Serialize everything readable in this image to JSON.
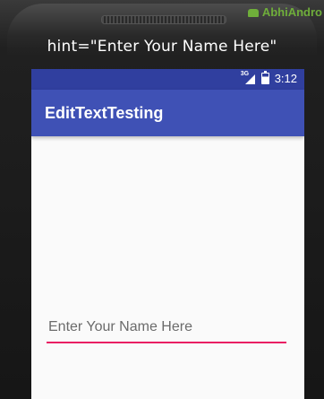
{
  "caption": "hint=\"Enter Your Name Here\"",
  "watermark": {
    "text": "AbhiAndro",
    "color": "#6fae3a"
  },
  "status_bar": {
    "network_label": "3G",
    "time": "3:12",
    "icons": [
      "signal-icon",
      "battery-icon"
    ],
    "color": "#303f9f"
  },
  "app_bar": {
    "title": "EditTextTesting",
    "color": "#3f51b5"
  },
  "edit_text": {
    "value": "",
    "placeholder": "Enter Your Name Here",
    "underline_color": "#e91e63"
  }
}
